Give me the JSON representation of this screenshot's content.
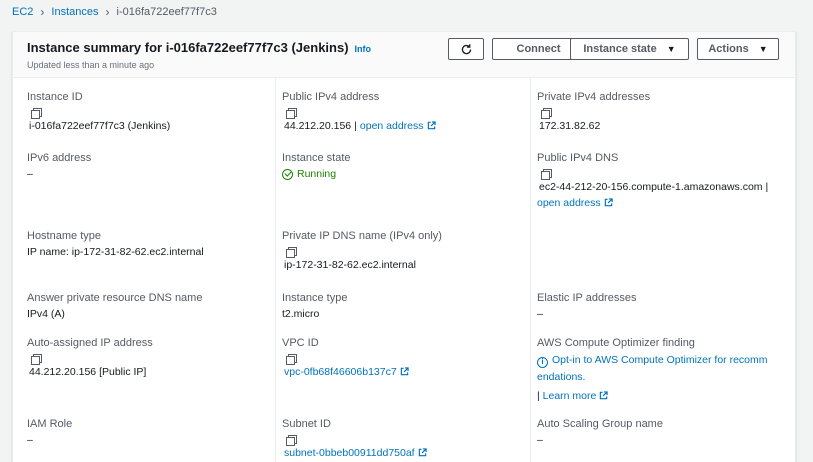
{
  "breadcrumb": {
    "ec2": "EC2",
    "instances": "Instances",
    "current": "i-016fa722eef77f7c3"
  },
  "header": {
    "title": "Instance summary for i-016fa722eef77f7c3 (Jenkins)",
    "info": "Info",
    "updated": "Updated less than a minute ago",
    "connect": "Connect",
    "instance_state": "Instance state",
    "actions": "Actions"
  },
  "fields": {
    "instance_id": {
      "label": "Instance ID",
      "value": "i-016fa722eef77f7c3 (Jenkins)"
    },
    "public_ipv4": {
      "label": "Public IPv4 address",
      "value": "44.212.20.156",
      "link": "open address"
    },
    "private_ipv4": {
      "label": "Private IPv4 addresses",
      "value": "172.31.82.62"
    },
    "ipv6": {
      "label": "IPv6 address",
      "value": "–"
    },
    "instance_state": {
      "label": "Instance state",
      "value": "Running"
    },
    "public_dns": {
      "label": "Public IPv4 DNS",
      "value": "ec2-44-212-20-156.compute-1.amazonaws.com",
      "link": "open address"
    },
    "hostname_type": {
      "label": "Hostname type",
      "value": "IP name: ip-172-31-82-62.ec2.internal"
    },
    "private_dns": {
      "label": "Private IP DNS name (IPv4 only)",
      "value": "ip-172-31-82-62.ec2.internal"
    },
    "answer_dns": {
      "label": "Answer private resource DNS name",
      "value": "IPv4 (A)"
    },
    "instance_type": {
      "label": "Instance type",
      "value": "t2.micro"
    },
    "elastic_ip": {
      "label": "Elastic IP addresses",
      "value": "–"
    },
    "auto_ip": {
      "label": "Auto-assigned IP address",
      "value": "44.212.20.156 [Public IP]"
    },
    "vpc_id": {
      "label": "VPC ID",
      "value": "vpc-0fb68f46606b137c7"
    },
    "optimizer": {
      "label": "AWS Compute Optimizer finding",
      "line1": "Opt-in to AWS Compute Optimizer for recomm",
      "line2": "endations.",
      "learn_more": "Learn more"
    },
    "iam_role": {
      "label": "IAM Role",
      "value": "–"
    },
    "subnet_id": {
      "label": "Subnet ID",
      "value": "subnet-0bbeb00911dd750af"
    },
    "asg_name": {
      "label": "Auto Scaling Group name",
      "value": "–"
    }
  },
  "colors": {
    "link": "#0073bb",
    "running": "#1d8102",
    "border": "#eaeded"
  }
}
